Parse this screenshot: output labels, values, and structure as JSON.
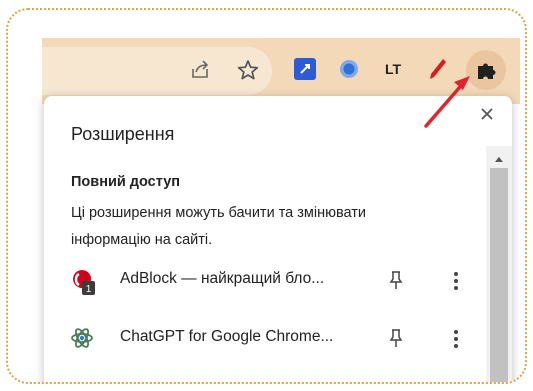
{
  "toolbar": {
    "icons": [
      "share-icon",
      "star-icon",
      "extension-icon",
      "extension-circle-icon",
      "languagetool-icon",
      "pen-icon",
      "puzzle-icon"
    ],
    "languagetool_label": "LT"
  },
  "panel": {
    "title": "Розширення",
    "section_title": "Повний доступ",
    "section_desc": "Ці розширення можуть бачити та змінювати інформацію на сайті.",
    "extensions": [
      {
        "name": "AdBlock — найкращий бло...",
        "badge": "1",
        "icon": "adblock-icon"
      },
      {
        "name": "ChatGPT for Google Chrome...",
        "icon": "chatgpt-icon"
      }
    ]
  },
  "colors": {
    "frame_border": "#e0a24a",
    "toolbar_bg": "#f3d9b8",
    "annotation_arrow": "#e0242f"
  }
}
